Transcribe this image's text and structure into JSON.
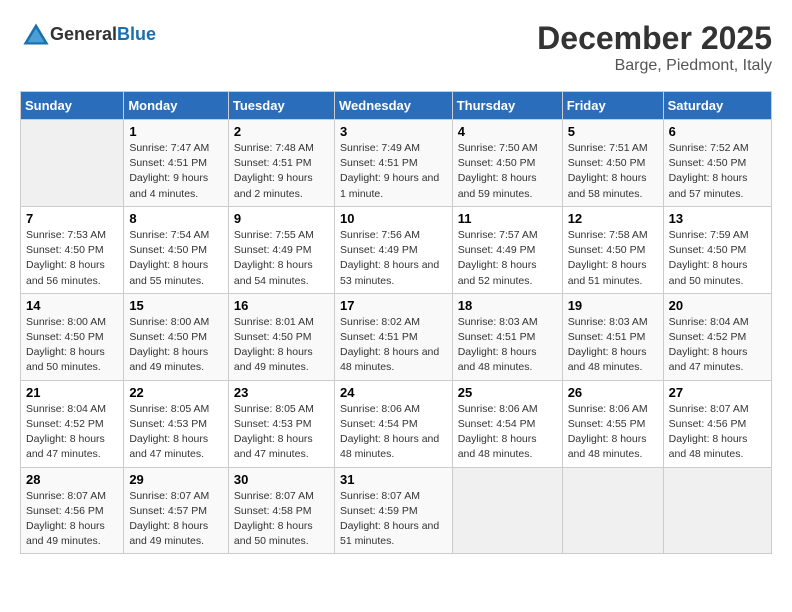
{
  "header": {
    "logo_general": "General",
    "logo_blue": "Blue",
    "title": "December 2025",
    "subtitle": "Barge, Piedmont, Italy"
  },
  "weekdays": [
    "Sunday",
    "Monday",
    "Tuesday",
    "Wednesday",
    "Thursday",
    "Friday",
    "Saturday"
  ],
  "weeks": [
    [
      {
        "day": "",
        "empty": true
      },
      {
        "day": "1",
        "sunrise": "Sunrise: 7:47 AM",
        "sunset": "Sunset: 4:51 PM",
        "daylight": "Daylight: 9 hours and 4 minutes."
      },
      {
        "day": "2",
        "sunrise": "Sunrise: 7:48 AM",
        "sunset": "Sunset: 4:51 PM",
        "daylight": "Daylight: 9 hours and 2 minutes."
      },
      {
        "day": "3",
        "sunrise": "Sunrise: 7:49 AM",
        "sunset": "Sunset: 4:51 PM",
        "daylight": "Daylight: 9 hours and 1 minute."
      },
      {
        "day": "4",
        "sunrise": "Sunrise: 7:50 AM",
        "sunset": "Sunset: 4:50 PM",
        "daylight": "Daylight: 8 hours and 59 minutes."
      },
      {
        "day": "5",
        "sunrise": "Sunrise: 7:51 AM",
        "sunset": "Sunset: 4:50 PM",
        "daylight": "Daylight: 8 hours and 58 minutes."
      },
      {
        "day": "6",
        "sunrise": "Sunrise: 7:52 AM",
        "sunset": "Sunset: 4:50 PM",
        "daylight": "Daylight: 8 hours and 57 minutes."
      }
    ],
    [
      {
        "day": "7",
        "sunrise": "Sunrise: 7:53 AM",
        "sunset": "Sunset: 4:50 PM",
        "daylight": "Daylight: 8 hours and 56 minutes."
      },
      {
        "day": "8",
        "sunrise": "Sunrise: 7:54 AM",
        "sunset": "Sunset: 4:50 PM",
        "daylight": "Daylight: 8 hours and 55 minutes."
      },
      {
        "day": "9",
        "sunrise": "Sunrise: 7:55 AM",
        "sunset": "Sunset: 4:49 PM",
        "daylight": "Daylight: 8 hours and 54 minutes."
      },
      {
        "day": "10",
        "sunrise": "Sunrise: 7:56 AM",
        "sunset": "Sunset: 4:49 PM",
        "daylight": "Daylight: 8 hours and 53 minutes."
      },
      {
        "day": "11",
        "sunrise": "Sunrise: 7:57 AM",
        "sunset": "Sunset: 4:49 PM",
        "daylight": "Daylight: 8 hours and 52 minutes."
      },
      {
        "day": "12",
        "sunrise": "Sunrise: 7:58 AM",
        "sunset": "Sunset: 4:50 PM",
        "daylight": "Daylight: 8 hours and 51 minutes."
      },
      {
        "day": "13",
        "sunrise": "Sunrise: 7:59 AM",
        "sunset": "Sunset: 4:50 PM",
        "daylight": "Daylight: 8 hours and 50 minutes."
      }
    ],
    [
      {
        "day": "14",
        "sunrise": "Sunrise: 8:00 AM",
        "sunset": "Sunset: 4:50 PM",
        "daylight": "Daylight: 8 hours and 50 minutes."
      },
      {
        "day": "15",
        "sunrise": "Sunrise: 8:00 AM",
        "sunset": "Sunset: 4:50 PM",
        "daylight": "Daylight: 8 hours and 49 minutes."
      },
      {
        "day": "16",
        "sunrise": "Sunrise: 8:01 AM",
        "sunset": "Sunset: 4:50 PM",
        "daylight": "Daylight: 8 hours and 49 minutes."
      },
      {
        "day": "17",
        "sunrise": "Sunrise: 8:02 AM",
        "sunset": "Sunset: 4:51 PM",
        "daylight": "Daylight: 8 hours and 48 minutes."
      },
      {
        "day": "18",
        "sunrise": "Sunrise: 8:03 AM",
        "sunset": "Sunset: 4:51 PM",
        "daylight": "Daylight: 8 hours and 48 minutes."
      },
      {
        "day": "19",
        "sunrise": "Sunrise: 8:03 AM",
        "sunset": "Sunset: 4:51 PM",
        "daylight": "Daylight: 8 hours and 48 minutes."
      },
      {
        "day": "20",
        "sunrise": "Sunrise: 8:04 AM",
        "sunset": "Sunset: 4:52 PM",
        "daylight": "Daylight: 8 hours and 47 minutes."
      }
    ],
    [
      {
        "day": "21",
        "sunrise": "Sunrise: 8:04 AM",
        "sunset": "Sunset: 4:52 PM",
        "daylight": "Daylight: 8 hours and 47 minutes."
      },
      {
        "day": "22",
        "sunrise": "Sunrise: 8:05 AM",
        "sunset": "Sunset: 4:53 PM",
        "daylight": "Daylight: 8 hours and 47 minutes."
      },
      {
        "day": "23",
        "sunrise": "Sunrise: 8:05 AM",
        "sunset": "Sunset: 4:53 PM",
        "daylight": "Daylight: 8 hours and 47 minutes."
      },
      {
        "day": "24",
        "sunrise": "Sunrise: 8:06 AM",
        "sunset": "Sunset: 4:54 PM",
        "daylight": "Daylight: 8 hours and 48 minutes."
      },
      {
        "day": "25",
        "sunrise": "Sunrise: 8:06 AM",
        "sunset": "Sunset: 4:54 PM",
        "daylight": "Daylight: 8 hours and 48 minutes."
      },
      {
        "day": "26",
        "sunrise": "Sunrise: 8:06 AM",
        "sunset": "Sunset: 4:55 PM",
        "daylight": "Daylight: 8 hours and 48 minutes."
      },
      {
        "day": "27",
        "sunrise": "Sunrise: 8:07 AM",
        "sunset": "Sunset: 4:56 PM",
        "daylight": "Daylight: 8 hours and 48 minutes."
      }
    ],
    [
      {
        "day": "28",
        "sunrise": "Sunrise: 8:07 AM",
        "sunset": "Sunset: 4:56 PM",
        "daylight": "Daylight: 8 hours and 49 minutes."
      },
      {
        "day": "29",
        "sunrise": "Sunrise: 8:07 AM",
        "sunset": "Sunset: 4:57 PM",
        "daylight": "Daylight: 8 hours and 49 minutes."
      },
      {
        "day": "30",
        "sunrise": "Sunrise: 8:07 AM",
        "sunset": "Sunset: 4:58 PM",
        "daylight": "Daylight: 8 hours and 50 minutes."
      },
      {
        "day": "31",
        "sunrise": "Sunrise: 8:07 AM",
        "sunset": "Sunset: 4:59 PM",
        "daylight": "Daylight: 8 hours and 51 minutes."
      },
      {
        "day": "",
        "empty": true
      },
      {
        "day": "",
        "empty": true
      },
      {
        "day": "",
        "empty": true
      }
    ]
  ]
}
